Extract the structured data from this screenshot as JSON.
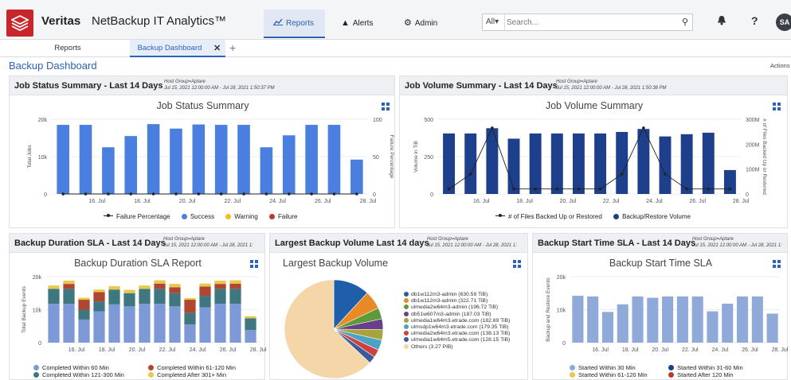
{
  "header": {
    "brand": "Veritas",
    "app_title": "NetBackup IT Analytics™",
    "nav": [
      {
        "label": "Reports",
        "icon": "chart-line-icon"
      },
      {
        "label": "Alerts",
        "icon": "warning-icon"
      },
      {
        "label": "Admin",
        "icon": "gear-icon"
      }
    ],
    "search_scope": "All",
    "search_placeholder": "Search...",
    "avatar": "SA"
  },
  "tabs": {
    "items": [
      "Reports",
      "Backup Dashboard"
    ],
    "active": "Backup Dashboard"
  },
  "dashboard": {
    "title": "Backup Dashboard",
    "actions": "Actions"
  },
  "colors": {
    "accent": "#2b63b5",
    "success": "#4a7fe0",
    "warning": "#f0c020",
    "failure": "#c0392b",
    "volume": "#1d3f8c",
    "start_sla": "#8fa9d8"
  },
  "panels": {
    "job_status": {
      "title": "Job Status Summary - Last 14 Days",
      "meta_line1": "Host Group=Aptare",
      "meta_line2": "Jul 15, 2021 12:00:00 AM - Jul 28, 2021 1:50:37 PM",
      "chart_title": "Job Status Summary"
    },
    "job_volume": {
      "title": "Job Volume Summary - Last 14 Days",
      "meta_line1": "Host Group=Aptare",
      "meta_line2": "Jul 15, 2021 12:00:00 AM - Jul 28, 2021 1:50:38 PM",
      "chart_title": "Job Volume Summary"
    },
    "duration_sla": {
      "title": "Backup Duration SLA - Last 14 Days",
      "meta_line1": "Host Group=Aptare",
      "meta_line2": "Jul 15, 2021 12:00:00 AM - Jul 28, 2021 1:",
      "chart_title": "Backup Duration SLA Report"
    },
    "largest_volume": {
      "title": "Largest Backup Volume Last 14 days",
      "meta_line1": "Host Group=Aptare",
      "meta_line2": "Jul 15, 2021 12:00:00 AM - Jul 28, 2021 1:",
      "chart_title": "Largest Backup Volume"
    },
    "start_time_sla": {
      "title": "Backup Start Time SLA - Last 14 Days",
      "meta_line1": "Host Group=Aptare",
      "meta_line2": "Jul 15, 2021 12:00:00 AM - Jul 28, 2021 1:",
      "chart_title": "Backup Start Time SLA"
    }
  },
  "chart_data": [
    {
      "id": "job_status",
      "type": "bar",
      "title": "Job Status Summary",
      "x": [
        "15. Jul",
        "16. Jul",
        "17. Jul",
        "18. Jul",
        "19. Jul",
        "20. Jul",
        "21. Jul",
        "22. Jul",
        "23. Jul",
        "24. Jul",
        "25. Jul",
        "26. Jul",
        "27. Jul",
        "28. Jul"
      ],
      "x_tick_labels": [
        "16. Jul",
        "18. Jul",
        "20. Jul",
        "22. Jul",
        "24. Jul",
        "26. Jul",
        "28. Jul"
      ],
      "ylabel": "Total Jobs",
      "y_ticks": [
        "0",
        "10k",
        "20k"
      ],
      "ylim": [
        0,
        20000
      ],
      "y2label": "Failure Percentage",
      "y2_ticks": [
        "0",
        "50",
        "100"
      ],
      "y2lim": [
        0,
        100
      ],
      "series": [
        {
          "name": "Success",
          "color": "#4a7fe0",
          "values": [
            18500,
            18500,
            12500,
            15500,
            18700,
            17500,
            18600,
            18500,
            18500,
            12500,
            15700,
            18500,
            18500,
            9200
          ]
        },
        {
          "name": "Warning",
          "color": "#f0c020",
          "values": [
            0,
            0,
            0,
            0,
            0,
            0,
            0,
            0,
            0,
            0,
            0,
            0,
            0,
            0
          ]
        },
        {
          "name": "Failure",
          "color": "#c0392b",
          "values": [
            0,
            0,
            0,
            0,
            0,
            0,
            0,
            0,
            0,
            0,
            0,
            0,
            0,
            0
          ]
        },
        {
          "name": "Failure Percentage",
          "type": "line",
          "axis": "y2",
          "color": "#222222",
          "values": [
            0,
            0,
            0,
            0,
            0,
            0,
            0,
            0,
            0,
            0,
            0,
            0,
            0,
            0
          ]
        }
      ],
      "legend": [
        "Failure Percentage",
        "Success",
        "Warning",
        "Failure"
      ],
      "legend_position": "bottom"
    },
    {
      "id": "job_volume",
      "type": "bar",
      "title": "Job Volume Summary",
      "x": [
        "15. Jul",
        "16. Jul",
        "17. Jul",
        "18. Jul",
        "19. Jul",
        "20. Jul",
        "21. Jul",
        "22. Jul",
        "23. Jul",
        "24. Jul",
        "25. Jul",
        "26. Jul",
        "27. Jul",
        "28. Jul"
      ],
      "x_tick_labels": [
        "16. Jul",
        "18. Jul",
        "20. Jul",
        "22. Jul",
        "24. Jul",
        "26. Jul",
        "28. Jul"
      ],
      "ylabel": "Volume in TiB",
      "y_ticks": [
        "0",
        "250",
        "500"
      ],
      "ylim": [
        0,
        500
      ],
      "y2label": "# of Files Backed Up or Restored",
      "y2_ticks": [
        "0",
        "100M",
        "200M",
        "300M"
      ],
      "y2lim": [
        0,
        300000000
      ],
      "series": [
        {
          "name": "Backup/Restore Volume",
          "color": "#1d3f8c",
          "values": [
            405,
            405,
            440,
            370,
            405,
            405,
            405,
            405,
            415,
            435,
            385,
            400,
            410,
            160
          ]
        },
        {
          "name": "# of Files Backed Up or Restored",
          "type": "line",
          "axis": "y2",
          "color": "#222222",
          "values": [
            20000000,
            80000000,
            265000000,
            20000000,
            20000000,
            20000000,
            20000000,
            20000000,
            80000000,
            265000000,
            80000000,
            20000000,
            20000000,
            20000000
          ]
        }
      ],
      "legend": [
        "# of Files Backed Up or Restored",
        "Backup/Restore Volume"
      ],
      "legend_position": "bottom"
    },
    {
      "id": "duration_sla",
      "type": "bar",
      "stacked": true,
      "title": "Backup Duration SLA Report",
      "x": [
        "15. Jul",
        "16. Jul",
        "17. Jul",
        "18. Jul",
        "19. Jul",
        "20. Jul",
        "21. Jul",
        "22. Jul",
        "23. Jul",
        "24. Jul",
        "25. Jul",
        "26. Jul",
        "27. Jul",
        "28. Jul"
      ],
      "x_tick_labels": [
        "16. Jul",
        "18. Jul",
        "20. Jul",
        "22. Jul",
        "24. Jul",
        "26. Jul",
        "28. Jul"
      ],
      "ylabel": "Total Backup Events",
      "y_ticks": [
        "0",
        "10k",
        "20k"
      ],
      "ylim": [
        0,
        20000
      ],
      "series": [
        {
          "name": "Completed Within 60 Min",
          "color": "#7d9ad6",
          "values": [
            11800,
            11800,
            7000,
            9500,
            11600,
            11000,
            11800,
            11800,
            11000,
            5500,
            10700,
            11800,
            11800,
            3800
          ]
        },
        {
          "name": "Completed Within 121-300 Min",
          "color": "#3f7780",
          "values": [
            4500,
            4500,
            3000,
            3000,
            4500,
            4000,
            4500,
            4500,
            4000,
            3500,
            3500,
            4500,
            4500,
            3600
          ]
        },
        {
          "name": "Completed Within 61-120 Min",
          "color": "#b04632",
          "values": [
            0,
            1500,
            3000,
            2800,
            0,
            0,
            0,
            1600,
            1800,
            4000,
            2800,
            1500,
            1600,
            0
          ]
        },
        {
          "name": "Completed After 301+ Min",
          "color": "#e8c94a",
          "values": [
            1000,
            1000,
            600,
            800,
            1000,
            1000,
            1000,
            1000,
            1000,
            500,
            900,
            1000,
            1000,
            600
          ]
        }
      ],
      "legend": [
        "Completed Within 60 Min",
        "Completed Within 61-120 Min",
        "Completed Within 121-300 Min",
        "Completed After 301+ Min"
      ],
      "legend_position": "bottom"
    },
    {
      "id": "largest_volume",
      "type": "pie",
      "title": "Largest Backup Volume",
      "slices": [
        {
          "label": "db1w112m3-admin (630.59 TiB)",
          "value": 630.59,
          "color": "#1f5ea8"
        },
        {
          "label": "db1w112m3-admin (322.71 TiB)",
          "value": 322.71,
          "color": "#e88a25"
        },
        {
          "label": "ulmedia2w64m3-admin (196.72 TiB)",
          "value": 196.72,
          "color": "#5f9a3a"
        },
        {
          "label": "db51w607m3-admin (187.03 TiB)",
          "value": 187.03,
          "color": "#6a3f8a"
        },
        {
          "label": "ulmedia1w64m3.etrade.com (182.69 TiB)",
          "value": 182.69,
          "color": "#a7a23a"
        },
        {
          "label": "ulmsdp1w64m3.etrade.com (179.35 TiB)",
          "value": 179.35,
          "color": "#4aa3c4"
        },
        {
          "label": "ulmedia2w64m3.etrade.com (138.13 TiB)",
          "value": 138.13,
          "color": "#d04040"
        },
        {
          "label": "ulmedia1w64m5.etrade.com (128.15 TiB)",
          "value": 128.15,
          "color": "#3a5a9a"
        },
        {
          "label": "Others (3.27 PiB)",
          "value": 3348.48,
          "color": "#f4d6a8"
        }
      ],
      "legend_position": "right"
    },
    {
      "id": "start_time_sla",
      "type": "bar",
      "stacked": true,
      "title": "Backup Start Time SLA",
      "x": [
        "15. Jul",
        "16. Jul",
        "17. Jul",
        "18. Jul",
        "19. Jul",
        "20. Jul",
        "21. Jul",
        "22. Jul",
        "23. Jul",
        "24. Jul",
        "25. Jul",
        "26. Jul",
        "27. Jul",
        "28. Jul"
      ],
      "x_tick_labels": [
        "16. Jul",
        "18. Jul",
        "20. Jul",
        "22. Jul",
        "24. Jul",
        "26. Jul",
        "28. Jul"
      ],
      "ylabel": "Backup and Restore Events",
      "y_ticks": [
        "0",
        "10k",
        "20k"
      ],
      "ylim": [
        0,
        20000
      ],
      "series": [
        {
          "name": "Started Within 30 Min",
          "color": "#8fa9d8",
          "values": [
            14200,
            14000,
            9300,
            11600,
            14000,
            13600,
            14000,
            14000,
            14000,
            9500,
            11800,
            14000,
            14000,
            8800
          ]
        },
        {
          "name": "Started Within 31-60 Min",
          "color": "#1d3f8c",
          "values": [
            0,
            0,
            0,
            0,
            0,
            0,
            0,
            0,
            0,
            0,
            0,
            0,
            0,
            0
          ]
        },
        {
          "name": "Started Within 61-120 Min",
          "color": "#e8c94a",
          "values": [
            0,
            0,
            0,
            0,
            0,
            0,
            0,
            0,
            0,
            0,
            0,
            0,
            0,
            0
          ]
        },
        {
          "name": "Started After 120 Min",
          "color": "#c0392b",
          "values": [
            0,
            0,
            0,
            0,
            0,
            0,
            0,
            0,
            0,
            0,
            0,
            0,
            0,
            0
          ]
        }
      ],
      "legend": [
        "Started Within 30 Min",
        "Started Within 31-60 Min",
        "Started Within 61-120 Min",
        "Started After 120 Min"
      ],
      "legend_position": "bottom"
    }
  ]
}
